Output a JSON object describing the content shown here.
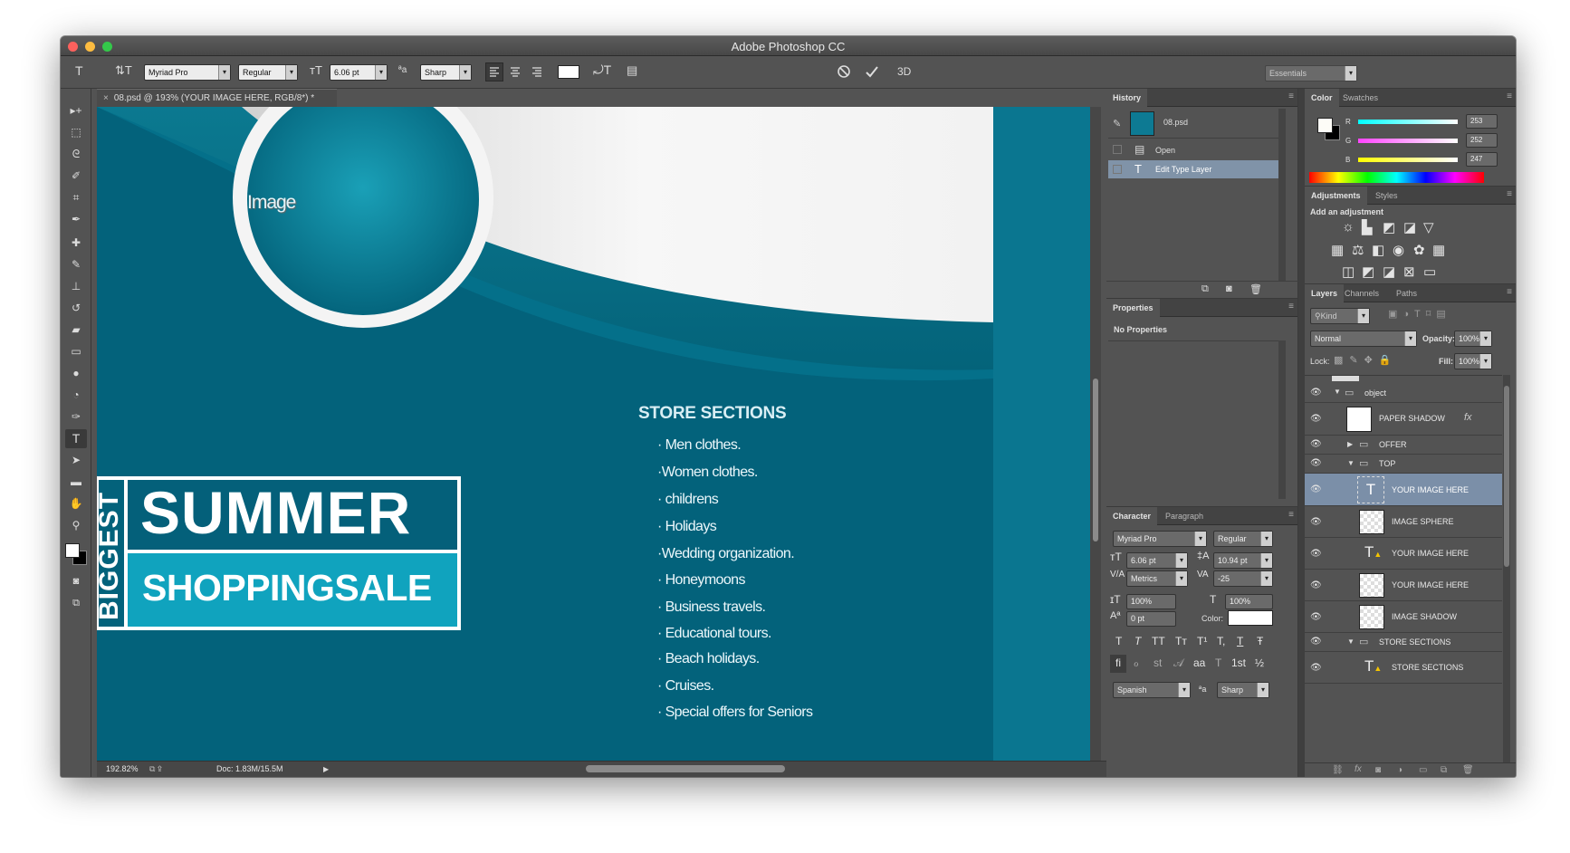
{
  "window": {
    "title": "Adobe Photoshop CC"
  },
  "options_bar": {
    "font_family": "Myriad Pro",
    "font_style": "Regular",
    "font_size": "6.06 pt",
    "antialias_icon": "ªa",
    "antialias": "Sharp",
    "mode_3d": "3D",
    "workspace": "Essentials"
  },
  "document": {
    "tab_title": "08.psd @ 193% (YOUR IMAGE HERE, RGB/8*) *",
    "zoom": "192.82%",
    "doc_info": "Doc: 1.83M/15.5M"
  },
  "artwork": {
    "image_text": "Image",
    "vertical_text": "BIGGEST",
    "headline": "SUMMER",
    "subhead": "SHOPPINGSALE",
    "store_heading": "STORE SECTIONS",
    "store_items": [
      "· Men clothes.",
      "·Women clothes.",
      "· childrens",
      "· Holidays",
      "·Wedding organization.",
      "· Honeymoons",
      "· Business travels.",
      "· Educational tours.",
      "· Beach holidays.",
      "· Cruises.",
      "· Special offers for Seniors"
    ]
  },
  "history": {
    "tab": "History",
    "snapshot": "08.psd",
    "items": [
      "Open",
      "Edit Type Layer"
    ]
  },
  "properties": {
    "tab": "Properties",
    "message": "No Properties"
  },
  "character": {
    "tabs": [
      "Character",
      "Paragraph"
    ],
    "font_family": "Myriad Pro",
    "font_style": "Regular",
    "size": "6.06 pt",
    "leading": "10.94 pt",
    "kerning": "Metrics",
    "tracking": "-25",
    "vscale": "100%",
    "hscale": "100%",
    "baseline": "0 pt",
    "color_label": "Color:",
    "language": "Spanish",
    "antialias_icon": "ªa",
    "antialias": "Sharp",
    "style_buttons": [
      "T",
      "T",
      "TT",
      "Tт",
      "T¹",
      "T,",
      "T",
      "Ŧ"
    ],
    "opentype_buttons": [
      "fi",
      "ℴ",
      "st",
      "𝒜",
      "aa",
      "T",
      "1st",
      "½"
    ]
  },
  "color": {
    "tabs": [
      "Color",
      "Swatches"
    ],
    "r_label": "R",
    "g_label": "G",
    "b_label": "B",
    "r": "253",
    "g": "252",
    "b": "247",
    "foreground": "#fdfcf7"
  },
  "adjustments": {
    "tabs": [
      "Adjustments",
      "Styles"
    ],
    "hint": "Add an adjustment"
  },
  "layers": {
    "tabs": [
      "Layers",
      "Channels",
      "Paths"
    ],
    "kind": "Kind",
    "blend": "Normal",
    "opacity_label": "Opacity:",
    "opacity": "100%",
    "lock_label": "Lock:",
    "fill_label": "Fill:",
    "fill": "100%",
    "rows": [
      {
        "name": "object",
        "type": "group"
      },
      {
        "name": "PAPER SHADOW",
        "type": "layer",
        "fx": "fx"
      },
      {
        "name": "OFFER",
        "type": "group"
      },
      {
        "name": "TOP",
        "type": "group"
      },
      {
        "name": "YOUR IMAGE HERE",
        "type": "text",
        "selected": true
      },
      {
        "name": "IMAGE SPHERE",
        "type": "layer"
      },
      {
        "name": "YOUR IMAGE HERE",
        "type": "text"
      },
      {
        "name": "YOUR IMAGE HERE",
        "type": "layer"
      },
      {
        "name": "IMAGE SHADOW",
        "type": "layer"
      },
      {
        "name": "STORE SECTIONS",
        "type": "group"
      },
      {
        "name": "STORE SECTIONS",
        "type": "text"
      }
    ]
  },
  "colors": {
    "accent": "#10a3be",
    "canvas_teal": "#02617b",
    "ui_gray": "#535353"
  }
}
